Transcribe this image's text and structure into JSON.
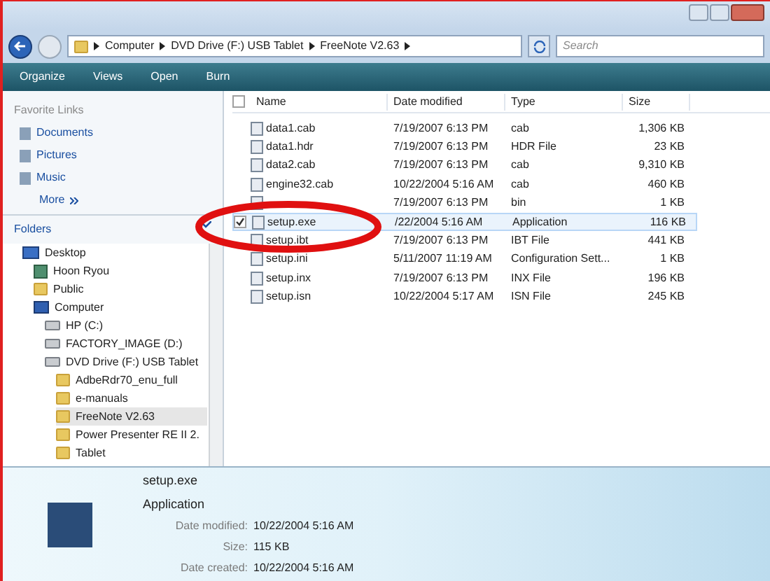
{
  "address": {
    "crumbs": [
      "Computer",
      "DVD Drive (F:) USB Tablet",
      "FreeNote V2.63"
    ]
  },
  "search": {
    "placeholder": "Search"
  },
  "toolbar": [
    "Organize",
    "Views",
    "Open",
    "Burn"
  ],
  "favorites": {
    "title": "Favorite Links",
    "items": [
      "Documents",
      "Pictures",
      "Music"
    ],
    "more": "More"
  },
  "folders": {
    "title": "Folders",
    "tree": [
      {
        "label": "Desktop",
        "kind": "desktop",
        "selected": false,
        "children": [
          {
            "label": "Hoon Ryou",
            "kind": "user",
            "selected": false
          },
          {
            "label": "Public",
            "kind": "folder",
            "selected": false
          },
          {
            "label": "Computer",
            "kind": "computer",
            "selected": false,
            "children": [
              {
                "label": "HP (C:)",
                "kind": "drive",
                "selected": false
              },
              {
                "label": "FACTORY_IMAGE (D:)",
                "kind": "drive",
                "selected": false
              },
              {
                "label": "DVD Drive (F:) USB Tablet",
                "kind": "drive",
                "selected": false,
                "children": [
                  {
                    "label": "AdbeRdr70_enu_full",
                    "kind": "folder",
                    "selected": false
                  },
                  {
                    "label": "e-manuals",
                    "kind": "folder",
                    "selected": false
                  },
                  {
                    "label": "FreeNote V2.63",
                    "kind": "folder",
                    "selected": true
                  },
                  {
                    "label": "Power Presenter RE II 2.",
                    "kind": "folder",
                    "selected": false
                  },
                  {
                    "label": "Tablet",
                    "kind": "folder",
                    "selected": false
                  }
                ]
              }
            ]
          }
        ]
      }
    ]
  },
  "table": {
    "all_checked": false,
    "columns": [
      "Name",
      "Date modified",
      "Type",
      "Size"
    ],
    "rows": [
      {
        "name": "data1.cab",
        "date": "7/19/2007 6:13 PM",
        "type": "cab",
        "size": "1,306 KB",
        "selected": false
      },
      {
        "name": "data1.hdr",
        "date": "7/19/2007 6:13 PM",
        "type": "HDR File",
        "size": "23 KB",
        "selected": false
      },
      {
        "name": "data2.cab",
        "date": "7/19/2007 6:13 PM",
        "type": "cab",
        "size": "9,310 KB",
        "selected": false
      },
      {
        "name": "engine32.cab",
        "date": "10/22/2004 5:16 AM",
        "type": "cab",
        "size": "460 KB",
        "selected": false
      },
      {
        "name": "",
        "date": "7/19/2007 6:13 PM",
        "type": "bin",
        "size": "1 KB",
        "selected": false
      },
      {
        "name": "setup.exe",
        "date": "/22/2004 5:16 AM",
        "type": "Application",
        "size": "116 KB",
        "selected": true
      },
      {
        "name": "setup.ibt",
        "date": "7/19/2007 6:13 PM",
        "type": "IBT File",
        "size": "441 KB",
        "selected": false
      },
      {
        "name": "setup.ini",
        "date": "5/11/2007 11:19 AM",
        "type": "Configuration Sett...",
        "size": "1 KB",
        "selected": false
      },
      {
        "name": "setup.inx",
        "date": "7/19/2007 6:13 PM",
        "type": "INX File",
        "size": "196 KB",
        "selected": false
      },
      {
        "name": "setup.isn",
        "date": "10/22/2004 5:17 AM",
        "type": "ISN File",
        "size": "245 KB",
        "selected": false
      }
    ]
  },
  "details": {
    "name": "setup.exe",
    "type": "Application",
    "fields": [
      {
        "label": "Date modified:",
        "value": "10/22/2004 5:16 AM"
      },
      {
        "label": "Size:",
        "value": "115 KB"
      },
      {
        "label": "Date created:",
        "value": "10/22/2004 5:16 AM"
      }
    ]
  }
}
